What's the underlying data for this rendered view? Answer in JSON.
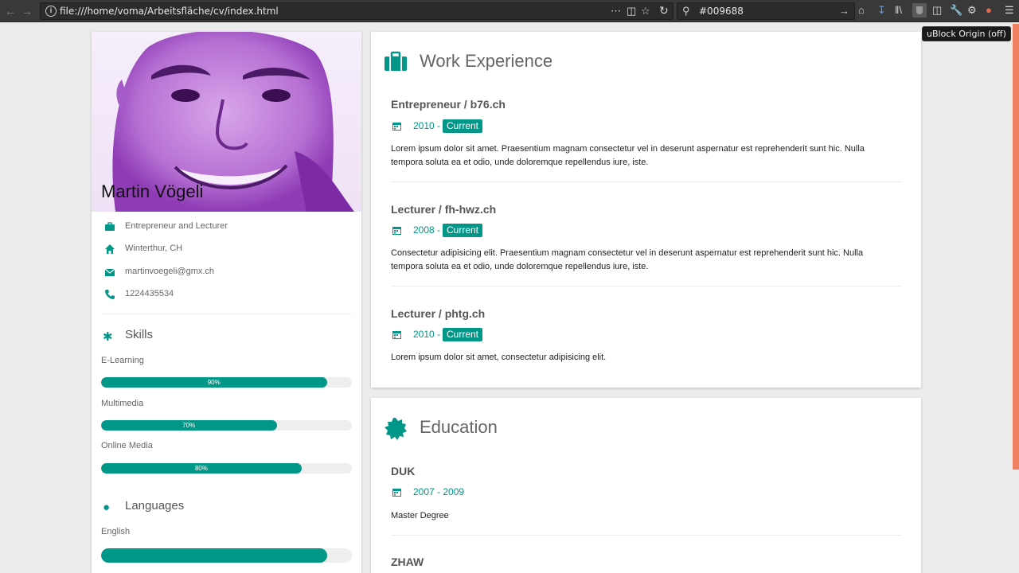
{
  "browser": {
    "url": "file:///home/voma/Arbeitsfläche/cv/index.html",
    "search_value": "#009688",
    "tooltip": "uBlock Origin (off)"
  },
  "profile": {
    "name": "Martin Vögeli",
    "info": [
      {
        "icon": "briefcase-icon",
        "text": "Entrepreneur and Lecturer"
      },
      {
        "icon": "home-icon",
        "text": "Winterthur, CH"
      },
      {
        "icon": "envelope-icon",
        "text": "martinvoegeli@gmx.ch"
      },
      {
        "icon": "phone-icon",
        "text": "1224435534"
      }
    ],
    "skills_title": "Skills",
    "skills": [
      {
        "label": "E-Learning",
        "percent": 90,
        "text": "90%"
      },
      {
        "label": "Multimedia",
        "percent": 70,
        "text": "70%"
      },
      {
        "label": "Online Media",
        "percent": 80,
        "text": "80%"
      }
    ],
    "languages_title": "Languages",
    "languages": [
      {
        "label": "English",
        "percent": 90
      }
    ]
  },
  "work": {
    "title": "Work Experience",
    "entries": [
      {
        "title": "Entrepreneur / b76.ch",
        "date": "2010 -",
        "badge": "Current",
        "desc_line1": "Lorem ipsum dolor sit amet. Praesentium magnam consectetur vel in deserunt aspernatur est reprehenderit sunt hic. Nulla",
        "desc_line2": "tempora soluta ea et odio, unde doloremque repellendus iure, iste."
      },
      {
        "title": "Lecturer / fh-hwz.ch",
        "date": "2008 -",
        "badge": "Current",
        "desc_line1": "Consectetur adipisicing elit. Praesentium magnam consectetur vel in deserunt aspernatur est reprehenderit sunt hic. Nulla",
        "desc_line2": "tempora soluta ea et odio, unde doloremque repellendus iure, iste."
      },
      {
        "title": "Lecturer / phtg.ch",
        "date": "2010 -",
        "badge": "Current",
        "desc_line1": "Lorem ipsum dolor sit amet, consectetur adipisicing elit.",
        "desc_line2": ""
      }
    ]
  },
  "education": {
    "title": "Education",
    "entries": [
      {
        "title": "DUK",
        "date": "2007 - 2009",
        "desc": "Master Degree"
      },
      {
        "title": "ZHAW"
      }
    ]
  },
  "colors": {
    "accent": "#009688",
    "page_bg": "#ececec",
    "toolbar_bg": "#393939"
  }
}
